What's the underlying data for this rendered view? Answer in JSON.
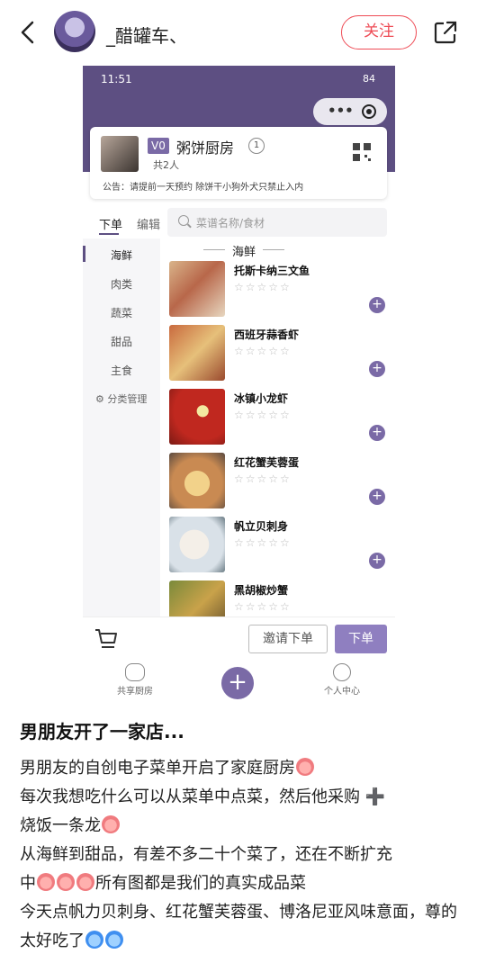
{
  "topbar": {
    "back_icon": "chevron-left-icon",
    "username": "_醋罐车、",
    "follow_label": "关注",
    "share_icon": "share-icon"
  },
  "phone": {
    "status_time": "11:51",
    "status_right": "84",
    "card": {
      "badge": "V0",
      "kitchen_name": "粥饼厨房",
      "level": "1",
      "members": "共2人",
      "notice": "公告：请提前一天预约 除饼干小狗外犬只禁止入内"
    },
    "tabs": {
      "order": "下单",
      "edit": "编辑"
    },
    "search_placeholder": "菜谱名称/食材",
    "categories": [
      {
        "label": "海鲜"
      },
      {
        "label": "肉类"
      },
      {
        "label": "蔬菜"
      },
      {
        "label": "甜品"
      },
      {
        "label": "主食"
      }
    ],
    "category_manage": "分类管理",
    "section_title": "海鲜",
    "dishes": [
      {
        "name": "托斯卡纳三文鱼",
        "stars": "☆☆☆☆☆"
      },
      {
        "name": "西班牙蒜香虾",
        "stars": "☆☆☆☆☆"
      },
      {
        "name": "冰镇小龙虾",
        "stars": "☆☆☆☆☆"
      },
      {
        "name": "红花蟹芙蓉蛋",
        "stars": "☆☆☆☆☆"
      },
      {
        "name": "帆立贝刺身",
        "stars": "☆☆☆☆☆"
      },
      {
        "name": "黑胡椒炒蟹",
        "stars": "☆☆☆☆☆"
      }
    ],
    "cart": {
      "invite_label": "邀请下单",
      "order_label": "下单"
    },
    "nav": {
      "left": "共享厨房",
      "plus": "+",
      "right": "个人中心"
    }
  },
  "post": {
    "title": "男朋友开了一家店...",
    "line1": "男朋友的自创电子菜单开启了家庭厨房",
    "line2a": "每次我想吃什么可以从菜单中点菜，然后他采购",
    "line2b": "烧饭一条龙",
    "line3a": "从海鲜到甜品，有差不多二十个菜了，还在不断扩充",
    "line3b": "中",
    "line3c": "所有图都是我们的真实成品菜",
    "line4": "今天点帆力贝刺身、红花蟹芙蓉蛋、博洛尼亚风味意面，尊的太好吃了",
    "plus_sign": "➕"
  }
}
